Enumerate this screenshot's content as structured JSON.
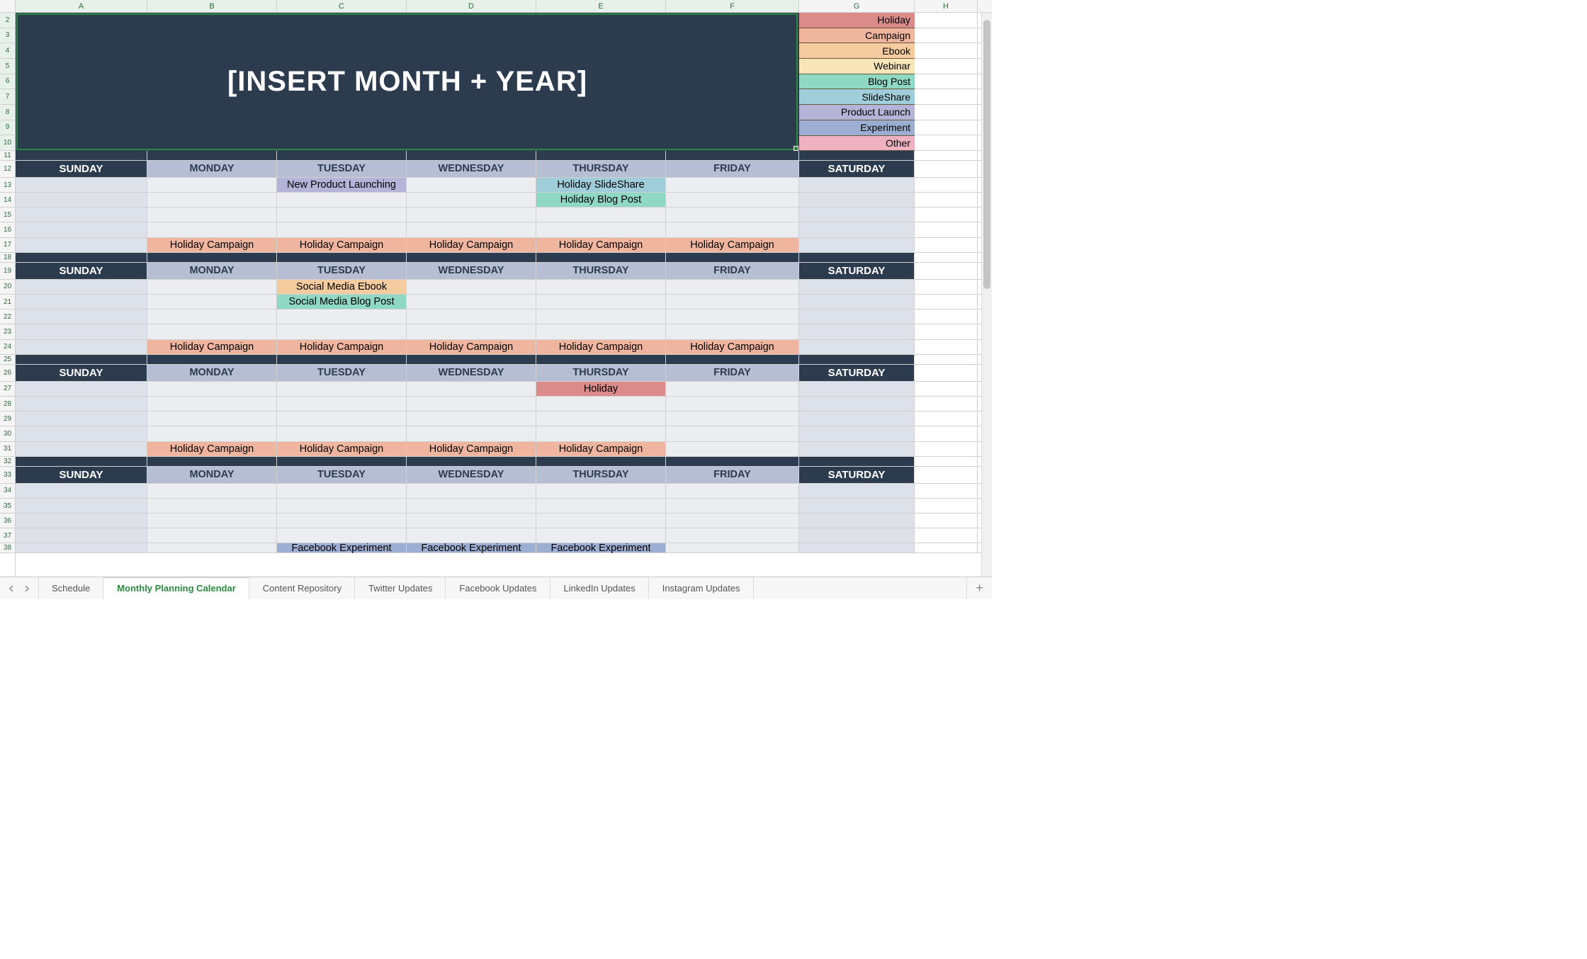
{
  "columns": [
    "A",
    "B",
    "C",
    "D",
    "E",
    "F",
    "G",
    "H"
  ],
  "row_numbers": [
    2,
    3,
    4,
    5,
    6,
    7,
    8,
    9,
    10,
    11,
    12,
    13,
    14,
    15,
    16,
    17,
    18,
    19,
    20,
    21,
    22,
    23,
    24,
    25,
    26,
    27,
    28,
    29,
    30,
    31,
    32,
    33,
    34,
    35,
    36,
    37,
    38
  ],
  "title": "[INSERT MONTH + YEAR]",
  "legend": [
    {
      "label": "Holiday",
      "cls": "bg-holiday"
    },
    {
      "label": "Campaign",
      "cls": "bg-campaign"
    },
    {
      "label": "Ebook",
      "cls": "bg-ebook"
    },
    {
      "label": "Webinar",
      "cls": "bg-webinar"
    },
    {
      "label": "Blog Post",
      "cls": "bg-blogpost"
    },
    {
      "label": "SlideShare",
      "cls": "bg-slideshare"
    },
    {
      "label": "Product Launch",
      "cls": "bg-productlaunch"
    },
    {
      "label": "Experiment",
      "cls": "bg-experiment"
    },
    {
      "label": "Other",
      "cls": "bg-other"
    }
  ],
  "days": [
    "SUNDAY",
    "MONDAY",
    "TUESDAY",
    "WEDNESDAY",
    "THURSDAY",
    "FRIDAY",
    "SATURDAY"
  ],
  "weeks": [
    {
      "rows": [
        [
          null,
          null,
          {
            "t": "New Product Launching",
            "c": "bg-productlaunch"
          },
          null,
          {
            "t": "Holiday SlideShare",
            "c": "bg-slideshare"
          },
          null,
          null
        ],
        [
          null,
          null,
          null,
          null,
          {
            "t": "Holiday Blog Post",
            "c": "bg-blogpost"
          },
          null,
          null
        ],
        [
          null,
          null,
          null,
          null,
          null,
          null,
          null
        ],
        [
          null,
          null,
          null,
          null,
          null,
          null,
          null
        ],
        [
          null,
          {
            "t": "Holiday Campaign",
            "c": "bg-campaign"
          },
          {
            "t": "Holiday Campaign",
            "c": "bg-campaign"
          },
          {
            "t": "Holiday Campaign",
            "c": "bg-campaign"
          },
          {
            "t": "Holiday Campaign",
            "c": "bg-campaign"
          },
          {
            "t": "Holiday Campaign",
            "c": "bg-campaign"
          },
          null
        ]
      ]
    },
    {
      "rows": [
        [
          null,
          null,
          {
            "t": "Social Media Ebook",
            "c": "bg-ebook"
          },
          null,
          null,
          null,
          null
        ],
        [
          null,
          null,
          {
            "t": "Social Media Blog Post",
            "c": "bg-blogpost"
          },
          null,
          null,
          null,
          null
        ],
        [
          null,
          null,
          null,
          null,
          null,
          null,
          null
        ],
        [
          null,
          null,
          null,
          null,
          null,
          null,
          null
        ],
        [
          null,
          {
            "t": "Holiday Campaign",
            "c": "bg-campaign"
          },
          {
            "t": "Holiday Campaign",
            "c": "bg-campaign"
          },
          {
            "t": "Holiday Campaign",
            "c": "bg-campaign"
          },
          {
            "t": "Holiday Campaign",
            "c": "bg-campaign"
          },
          {
            "t": "Holiday Campaign",
            "c": "bg-campaign"
          },
          null
        ]
      ]
    },
    {
      "rows": [
        [
          null,
          null,
          null,
          null,
          {
            "t": "Holiday",
            "c": "bg-holiday"
          },
          null,
          null
        ],
        [
          null,
          null,
          null,
          null,
          null,
          null,
          null
        ],
        [
          null,
          null,
          null,
          null,
          null,
          null,
          null
        ],
        [
          null,
          null,
          null,
          null,
          null,
          null,
          null
        ],
        [
          null,
          {
            "t": "Holiday Campaign",
            "c": "bg-campaign"
          },
          {
            "t": "Holiday Campaign",
            "c": "bg-campaign"
          },
          {
            "t": "Holiday Campaign",
            "c": "bg-campaign"
          },
          {
            "t": "Holiday Campaign",
            "c": "bg-campaign"
          },
          null,
          null
        ]
      ]
    },
    {
      "rows": [
        [
          null,
          null,
          null,
          null,
          null,
          null,
          null
        ],
        [
          null,
          null,
          null,
          null,
          null,
          null,
          null
        ],
        [
          null,
          null,
          null,
          null,
          null,
          null,
          null
        ],
        [
          null,
          null,
          null,
          null,
          null,
          null,
          null
        ],
        [
          null,
          null,
          {
            "t": "Facebook Experiment",
            "c": "bg-experiment"
          },
          {
            "t": "Facebook Experiment",
            "c": "bg-experiment"
          },
          {
            "t": "Facebook Experiment",
            "c": "bg-experiment"
          },
          null,
          null
        ]
      ],
      "partial": true
    }
  ],
  "sheet_tabs": [
    "Schedule",
    "Monthly Planning Calendar",
    "Content Repository",
    "Twitter Updates",
    "Facebook Updates",
    "LinkedIn Updates",
    "Instagram Updates"
  ],
  "active_tab": 1
}
